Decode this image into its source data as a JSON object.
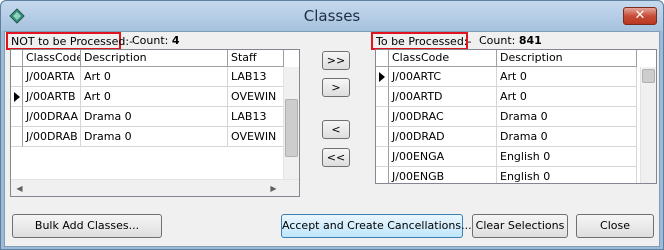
{
  "window": {
    "title": "Classes",
    "close_glyph": "✕"
  },
  "left": {
    "label": "NOT to be Processed:-",
    "count_label": "Count:",
    "count": "4",
    "columns": [
      "ClassCode",
      "Description",
      "Staff"
    ],
    "rows": [
      [
        "J/00ARTA",
        "Art 0",
        "LAB13"
      ],
      [
        "J/00ARTB",
        "Art 0",
        "OVEWIN"
      ],
      [
        "J/00DRAA",
        "Drama 0",
        "LAB13"
      ],
      [
        "J/00DRAB",
        "Drama 0",
        "OVEWIN"
      ]
    ],
    "current_row": 1
  },
  "right": {
    "label": "To be Processed:-",
    "count_label": "Count:",
    "count": "841",
    "columns": [
      "ClassCode",
      "Description"
    ],
    "rows": [
      [
        "J/00ARTC",
        "Art 0"
      ],
      [
        "J/00ARTD",
        "Art 0"
      ],
      [
        "J/00DRAC",
        "Drama 0"
      ],
      [
        "J/00DRAD",
        "Drama 0"
      ],
      [
        "J/00ENGA",
        "English 0"
      ],
      [
        "J/00ENGB",
        "English 0"
      ]
    ],
    "current_row": 0
  },
  "move_buttons": [
    ">>",
    ">",
    "<",
    "<<"
  ],
  "footer": {
    "bulk_add": "Bulk Add Classes...",
    "accept": "Accept and Create Cancellations...",
    "clear": "Clear Selections",
    "close": "Close"
  },
  "colors": {
    "highlight_border": "#e0141e",
    "title_bar": "#a7c2de",
    "client_bg": "#f0f0f0"
  },
  "icons": {
    "app": "app-diamond-icon",
    "close": "close-icon",
    "row_pointer": "row-pointer-icon"
  }
}
